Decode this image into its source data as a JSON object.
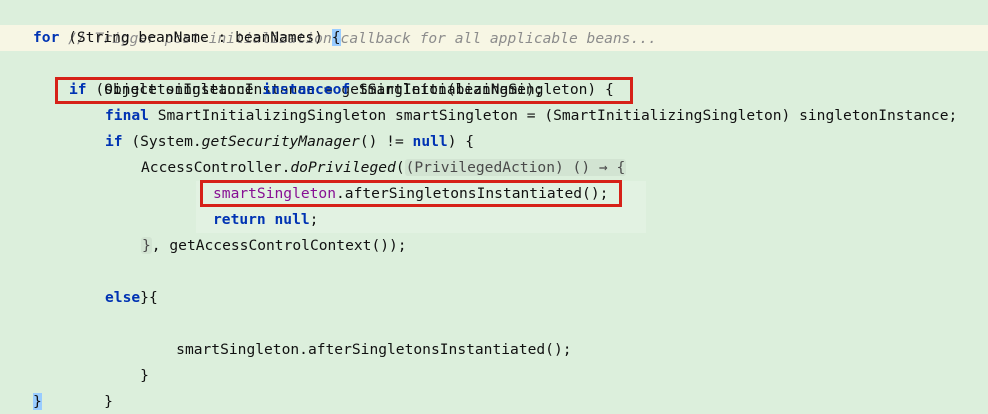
{
  "editor": {
    "language": "Java",
    "colors": {
      "background": "#dcefdc",
      "keyword": "#0033b3",
      "comment": "#8c8c8c",
      "field": "#871094",
      "highlight_box": "#d62118",
      "brace_match": "#99ccff"
    },
    "lines": {
      "l1_comment": "// Trigger post-initialization callback for all applicable beans...",
      "l2_for": "for",
      "l2_rest": " (String beanName : beanNames) ",
      "l2_brace": "{",
      "l3": "Object singletonInstance = getSingleton(beanName);",
      "l4_if": "if",
      "l4_mid": " (singletonInstance ",
      "l4_instanceof": "instanceof",
      "l4_rest": " SmartInitializingSingleton) {",
      "l5_final": "final",
      "l5_rest": " SmartInitializingSingleton smartSingleton = (SmartInitializingSingleton) singletonInstance;",
      "l6_if": "if",
      "l6_a": " (System.",
      "l6_method": "getSecurityManager",
      "l6_b": "() != ",
      "l6_null": "null",
      "l6_c": ") {",
      "l7_a": "AccessController.",
      "l7_method": "doPrivileged",
      "l7_b": "(",
      "l7_hint": "(PrivilegedAction) () → {",
      "l8_field": "smartSingleton",
      "l8_rest": ".afterSingletonsInstantiated();",
      "l9_return": "return",
      "l9_sp": " ",
      "l9_null": "null",
      "l9_semi": ";",
      "l10_brace": "}",
      "l10_rest": ", getAccessControlContext());",
      "l11": "}",
      "l12_else": "else",
      "l12_rest": " {",
      "l13": "smartSingleton.afterSingletonsInstantiated();",
      "l14": "}",
      "l15": "}",
      "l16": "}"
    }
  }
}
